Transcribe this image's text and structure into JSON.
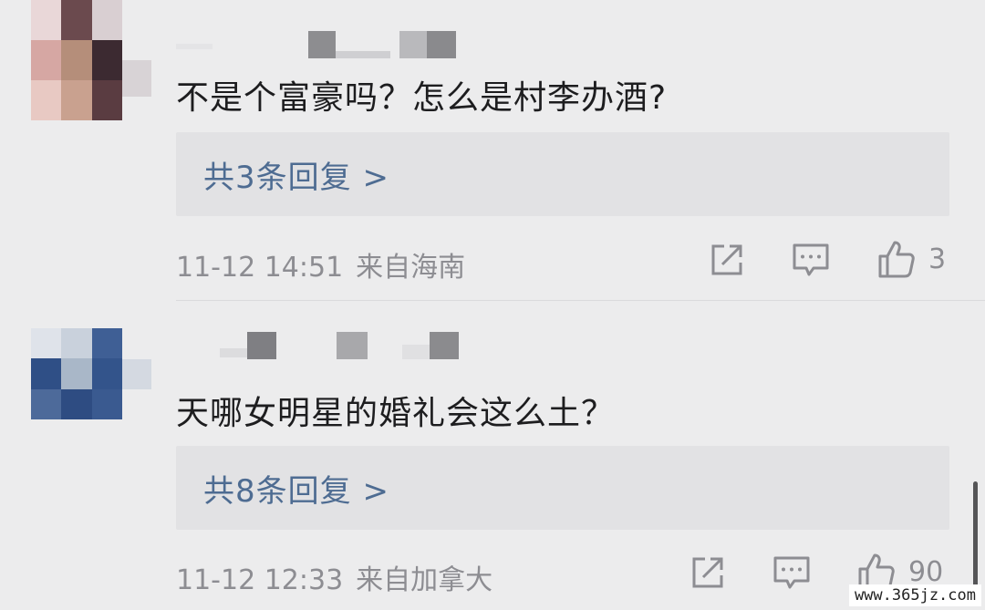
{
  "comments": [
    {
      "text": "不是个富豪吗？怎么是村李办酒?",
      "reply_label": "共3条回复 >",
      "timestamp": "11-12 14:51",
      "location": "来自海南",
      "like_count": "3",
      "avatar_colors": [
        "#e9d7d8",
        "#6b4a4e",
        "#d9cfd2",
        "#d6a7a3",
        "#b58e7a",
        "#3c2a31",
        "#e8c9c3",
        "#c9a18f",
        "#5a3c41"
      ]
    },
    {
      "text": "天哪女明星的婚礼会这么土？",
      "reply_label": "共8条回复 >",
      "timestamp": "11-12 12:33",
      "location": "来自加拿大",
      "like_count": "90",
      "avatar_colors": [
        "#dfe3ea",
        "#c9d1dc",
        "#3f5f95",
        "#2f4f86",
        "#a9b7c8",
        "#33548b",
        "#4d6a9a",
        "#2e4c82",
        "#3a5a90"
      ]
    }
  ],
  "icons": {
    "share": "share-icon",
    "comment": "comment-icon",
    "like": "thumbs-up-icon"
  },
  "colors": {
    "background": "#ececed",
    "reply_box": "#e2e2e4",
    "link": "#4e6c92",
    "meta_text": "#8d8d92",
    "body_text": "#1d1d1f"
  },
  "watermark": "www.365jz.com"
}
